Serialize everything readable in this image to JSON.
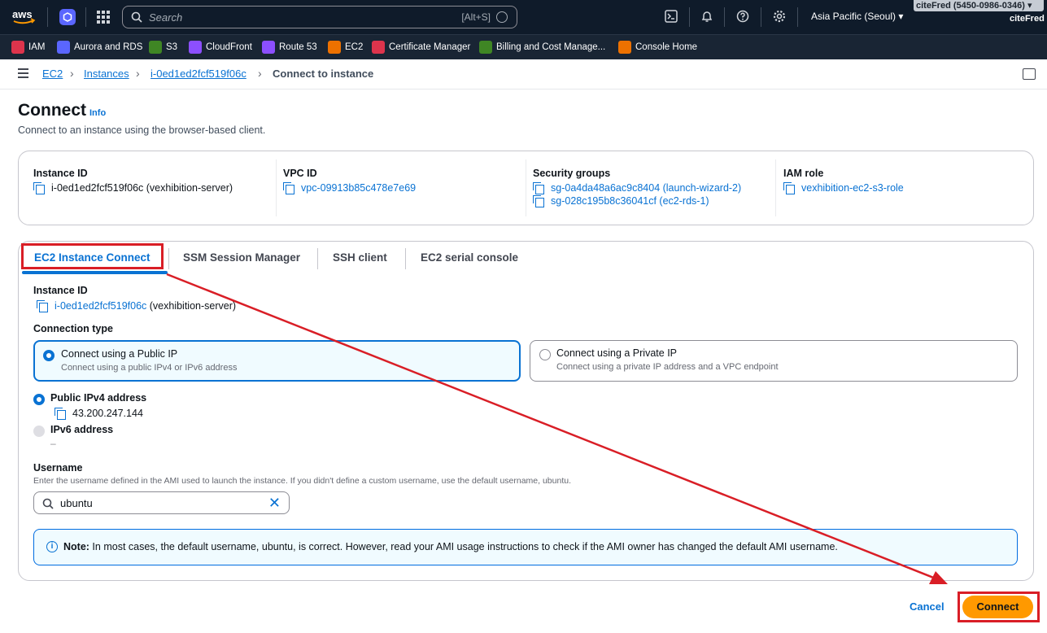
{
  "topnav": {
    "logo_text": "aws",
    "search_placeholder": "Search",
    "search_shortcut": "[Alt+S]",
    "region": "Asia Pacific (Seoul) ▾",
    "account": "citeFred (5450-0986-0346) ▾",
    "user": "citeFred",
    "icons": [
      "cloudshell-icon",
      "bell-icon",
      "help-icon",
      "settings-icon"
    ]
  },
  "favorites": [
    {
      "label": "IAM",
      "color": "#dd344c"
    },
    {
      "label": "Aurora and RDS",
      "color": "#5a66ff"
    },
    {
      "label": "S3",
      "color": "#3f8624"
    },
    {
      "label": "CloudFront",
      "color": "#8c4fff"
    },
    {
      "label": "Route 53",
      "color": "#8c4fff"
    },
    {
      "label": "EC2",
      "color": "#ed7100"
    },
    {
      "label": "Certificate Manager",
      "color": "#dd344c"
    },
    {
      "label": "Billing and Cost Manage...",
      "color": "#3f8624"
    },
    {
      "label": "Console Home",
      "color": "#ed7100"
    }
  ],
  "breadcrumb": [
    "EC2",
    "Instances",
    "i-0ed1ed2fcf519f06c",
    "Connect to instance"
  ],
  "page": {
    "title": "Connect",
    "info": "Info",
    "subtitle": "Connect to an instance using the browser-based client."
  },
  "summary": {
    "instance_label": "Instance ID",
    "instance_value": "i-0ed1ed2fcf519f06c (vexhibition-server)",
    "vpc_label": "VPC ID",
    "vpc_value": "vpc-09913b85c478e7e69",
    "sg_label": "Security groups",
    "sg_values": [
      "sg-0a4da48a6ac9c8404 (launch-wizard-2)",
      "sg-028c195b8c36041cf (ec2-rds-1)"
    ],
    "iam_label": "IAM role",
    "iam_value": "vexhibition-ec2-s3-role"
  },
  "tabs": [
    "EC2 Instance Connect",
    "SSM Session Manager",
    "SSH client",
    "EC2 serial console"
  ],
  "form": {
    "instance_label": "Instance ID",
    "instance_link": "i-0ed1ed2fcf519f06c",
    "instance_suffix": "(vexhibition-server)",
    "conn_type_label": "Connection type",
    "public_title": "Connect using a Public IP",
    "public_desc": "Connect using a public IPv4 or IPv6 address",
    "private_title": "Connect using a Private IP",
    "private_desc": "Connect using a private IP address and a VPC endpoint",
    "ipv4_label": "Public IPv4 address",
    "ipv4_value": "43.200.247.144",
    "ipv6_label": "IPv6 address",
    "ipv6_value": "–",
    "username_label": "Username",
    "username_hint": "Enter the username defined in the AMI used to launch the instance. If you didn't define a custom username, use the default username, ubuntu.",
    "username_value": "ubuntu",
    "note_bold": "Note:",
    "note_text": " In most cases, the default username, ubuntu, is correct. However, read your AMI usage instructions to check if the AMI owner has changed the default AMI username."
  },
  "actions": {
    "cancel": "Cancel",
    "connect": "Connect"
  },
  "colors": {
    "link": "#0972d3",
    "primary_button": "#ff9900",
    "annotation": "#d91e26"
  }
}
